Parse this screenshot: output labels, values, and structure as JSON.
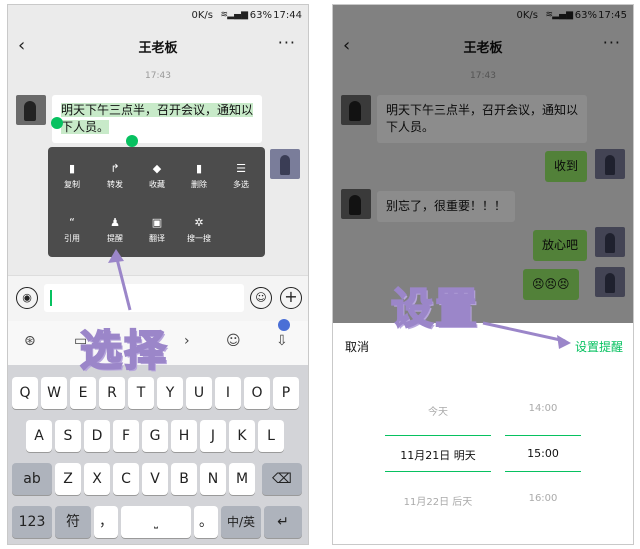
{
  "left": {
    "status": {
      "speed": "0K/s",
      "battery": "63%",
      "time": "17:44"
    },
    "nav": {
      "back": "‹",
      "title": "王老板",
      "more": "···"
    },
    "timestamp": "17:43",
    "message": "明天下午三点半，召开会议，通知以下人员。",
    "context_menu": [
      {
        "icon": "▮",
        "label": "复制"
      },
      {
        "icon": "↱",
        "label": "转发"
      },
      {
        "icon": "◆",
        "label": "收藏"
      },
      {
        "icon": "▮",
        "label": "删除"
      },
      {
        "icon": "☰",
        "label": "多选"
      },
      {
        "icon": "“",
        "label": "引用"
      },
      {
        "icon": "♟",
        "label": "提醒"
      },
      {
        "icon": "▣",
        "label": "翻译"
      },
      {
        "icon": "✲",
        "label": "搜一搜"
      }
    ],
    "annotation": "选择",
    "keyboard": {
      "row1": [
        "Q",
        "W",
        "E",
        "R",
        "T",
        "Y",
        "U",
        "I",
        "O",
        "P"
      ],
      "row2": [
        "A",
        "S",
        "D",
        "F",
        "G",
        "H",
        "J",
        "K",
        "L"
      ],
      "row3_left": "ab",
      "row3": [
        "Z",
        "X",
        "C",
        "V",
        "B",
        "N",
        "M"
      ],
      "row4_left": "123",
      "row4_fu": "符",
      "row4_comma": "，",
      "row4_period": "。",
      "row4_lang": "中/英",
      "row4_enter": "↵"
    }
  },
  "right": {
    "status": {
      "speed": "0K/s",
      "battery": "63%",
      "time": "17:45"
    },
    "nav": {
      "back": "‹",
      "title": "王老板",
      "more": "···"
    },
    "timestamp": "17:43",
    "messages": [
      {
        "side": "left",
        "text": "明天下午三点半，召开会议，通知以下人员。"
      },
      {
        "side": "right",
        "text": "收到"
      },
      {
        "side": "left",
        "text": "别忘了，很重要！！！"
      },
      {
        "side": "right",
        "text": "放心吧"
      },
      {
        "side": "right",
        "text": "😣😣😣"
      }
    ],
    "annotation": "设置",
    "sheet": {
      "cancel": "取消",
      "confirm": "设置提醒",
      "dates": [
        "今天",
        "11月21日 明天",
        "11月22日 后天"
      ],
      "times": [
        "14:00",
        "15:00",
        "16:00"
      ]
    }
  },
  "colors": {
    "accent": "#07c160",
    "bubble_right": "#95ec69",
    "menu": "#4c4c4c",
    "annotation": "#9b86c9"
  }
}
